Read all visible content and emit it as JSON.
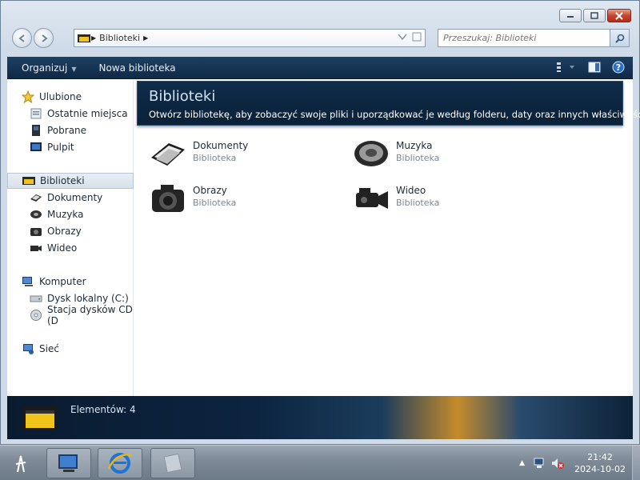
{
  "window": {
    "caption_buttons": [
      "minimize-icon",
      "maximize-icon",
      "close-icon"
    ]
  },
  "address": {
    "crumb": "Biblioteki",
    "search_placeholder": "Przeszukaj: Biblioteki"
  },
  "toolbar": {
    "organize": "Organizuj",
    "new_library": "Nowa biblioteka"
  },
  "nav": {
    "favorites": "Ulubione",
    "recent": "Ostatnie miejsca",
    "downloads": "Pobrane",
    "desktop": "Pulpit",
    "libraries": "Biblioteki",
    "documents": "Dokumenty",
    "music": "Muzyka",
    "pictures": "Obrazy",
    "video": "Wideo",
    "computer": "Komputer",
    "local_disk": "Dysk lokalny (C:)",
    "cd_drive": "Stacja dysków CD (D",
    "network": "Sieć"
  },
  "banner": {
    "title": "Biblioteki",
    "description": "Otwórz bibliotekę, aby zobaczyć swoje pliki i uporządkować je według folderu, daty oraz innych właściwości."
  },
  "libraries": [
    {
      "name": "Dokumenty",
      "type": "Biblioteka"
    },
    {
      "name": "Muzyka",
      "type": "Biblioteka"
    },
    {
      "name": "Obrazy",
      "type": "Biblioteka"
    },
    {
      "name": "Wideo",
      "type": "Biblioteka"
    }
  ],
  "status": {
    "count": "Elementów: 4"
  },
  "taskbar": {
    "time": "21:42",
    "date": "2024-10-02"
  },
  "colors": {
    "toolbar": "#12304f",
    "accent": "#c58b2a",
    "close": "#c8442f"
  }
}
